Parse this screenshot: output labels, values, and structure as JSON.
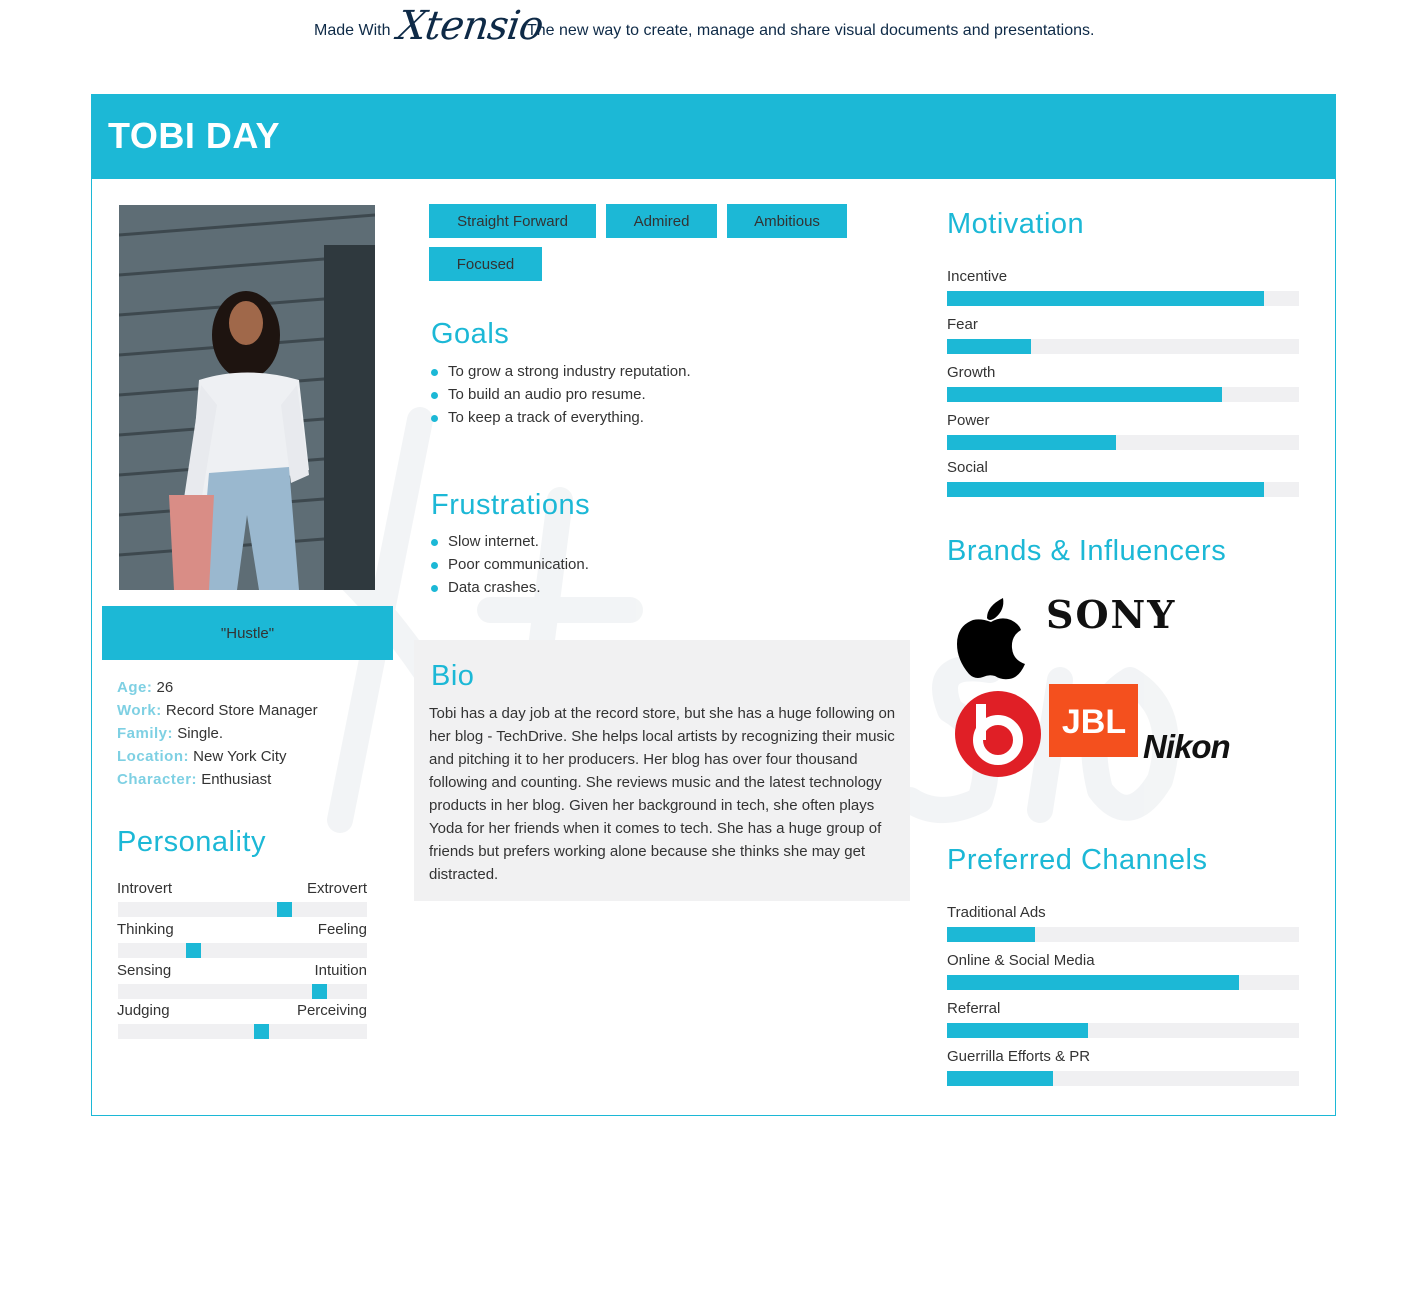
{
  "banner": {
    "made_with": "Made With",
    "logo": "Xtensio",
    "tagline": "The new way to create, manage and share visual documents and presentations."
  },
  "persona": {
    "name": "TOBI DAY",
    "quote": "\"Hustle\"",
    "info": [
      {
        "key": "Age:",
        "value": "26"
      },
      {
        "key": "Work:",
        "value": "Record Store Manager"
      },
      {
        "key": "Family:",
        "value": "Single."
      },
      {
        "key": "Location:",
        "value": "New York City"
      },
      {
        "key": "Character:",
        "value": "Enthusiast"
      }
    ]
  },
  "personality": {
    "title": "Personality",
    "traits": [
      {
        "left": "Introvert",
        "right": "Extrovert",
        "level": 0.68
      },
      {
        "left": "Thinking",
        "right": "Feeling",
        "level": 0.29
      },
      {
        "left": "Sensing",
        "right": "Intuition",
        "level": 0.83
      },
      {
        "left": "Judging",
        "right": "Perceiving",
        "level": 0.58
      }
    ]
  },
  "tags": [
    "Straight Forward",
    "Admired",
    "Ambitious",
    "Focused"
  ],
  "goals": {
    "title": "Goals",
    "items": [
      "To grow a strong industry reputation.",
      "To build an audio pro resume.",
      "To keep a track of everything."
    ]
  },
  "frustrations": {
    "title": "Frustrations",
    "items": [
      "Slow internet.",
      "Poor communication.",
      "Data crashes."
    ]
  },
  "bio": {
    "title": "Bio",
    "text": "Tobi has a day job at the record store, but she has a huge following on her blog - TechDrive. She helps local artists by recognizing their music and pitching it to her producers. Her blog has over four thousand following and counting. She reviews music and the latest technology products in her blog. Given her background in tech, she often plays Yoda for her friends when it comes to tech. She has a huge group of friends but prefers working alone because she thinks she may get distracted."
  },
  "motivation": {
    "title": "Motivation",
    "items": [
      {
        "label": "Incentive",
        "level": 0.9
      },
      {
        "label": "Fear",
        "level": 0.24
      },
      {
        "label": "Growth",
        "level": 0.78
      },
      {
        "label": "Power",
        "level": 0.48
      },
      {
        "label": "Social",
        "level": 0.9
      }
    ]
  },
  "brands": {
    "title": "Brands & Influencers",
    "logos": [
      "apple-logo",
      "SONY",
      "beats-logo",
      "JBL",
      "Nikon"
    ]
  },
  "channels": {
    "title": "Preferred Channels",
    "items": [
      {
        "label": "Traditional Ads",
        "level": 0.25
      },
      {
        "label": "Online & Social Media",
        "level": 0.83
      },
      {
        "label": "Referral",
        "level": 0.4
      },
      {
        "label": "Guerrilla Efforts & PR",
        "level": 0.3
      }
    ]
  },
  "colors": {
    "accent": "#1cb8d6",
    "track": "#f0f0f2",
    "label_light": "#7ed0e3",
    "banner_text": "#0e2a47"
  }
}
